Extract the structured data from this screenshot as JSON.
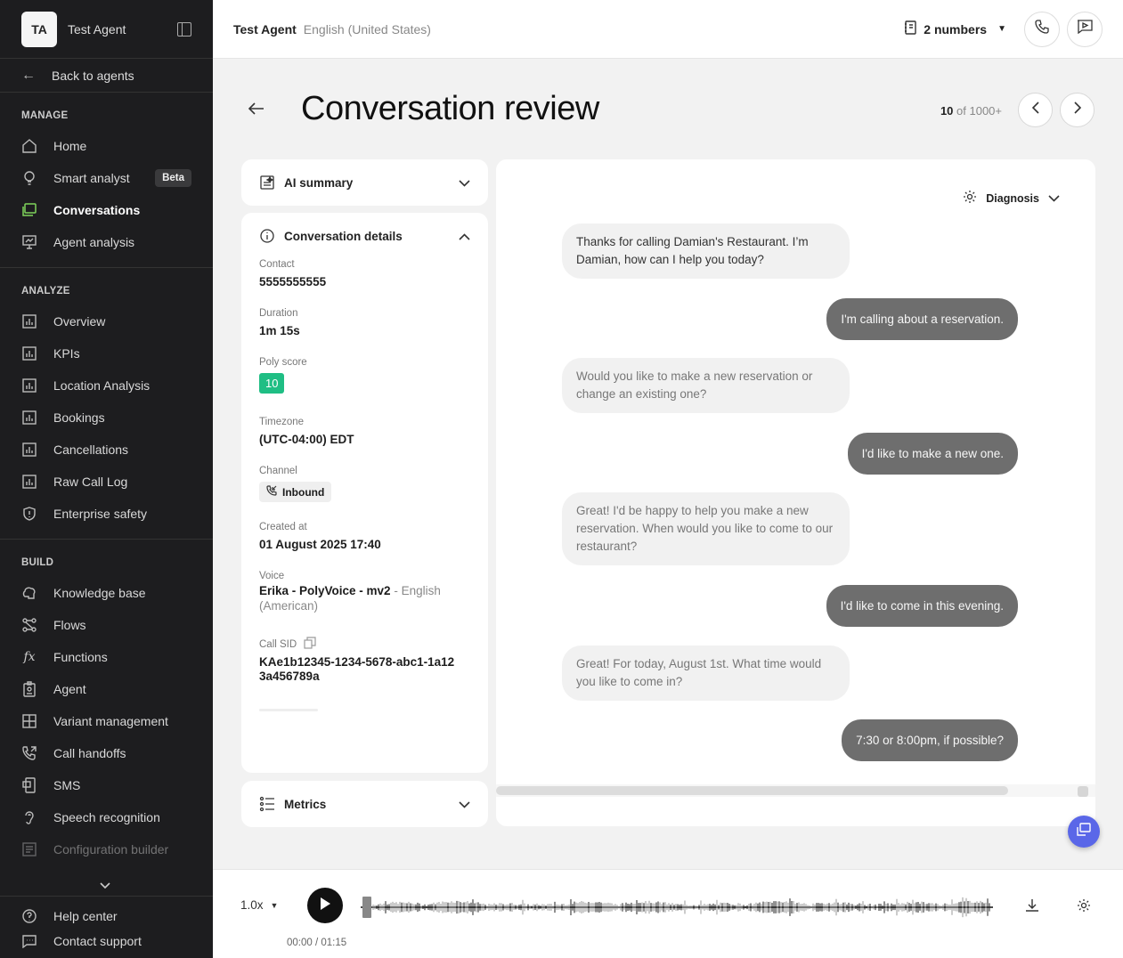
{
  "sidebar": {
    "avatar": "TA",
    "agent_name": "Test Agent",
    "back_label": "Back to agents",
    "manage": {
      "title": "MANAGE",
      "items": [
        {
          "label": "Home"
        },
        {
          "label": "Smart analyst",
          "badge": "Beta"
        },
        {
          "label": "Conversations"
        },
        {
          "label": "Agent analysis"
        }
      ]
    },
    "analyze": {
      "title": "ANALYZE",
      "items": [
        {
          "label": "Overview"
        },
        {
          "label": "KPIs"
        },
        {
          "label": "Location Analysis"
        },
        {
          "label": "Bookings"
        },
        {
          "label": "Cancellations"
        },
        {
          "label": "Raw Call Log"
        },
        {
          "label": "Enterprise safety"
        }
      ]
    },
    "build": {
      "title": "BUILD",
      "items": [
        {
          "label": "Knowledge base"
        },
        {
          "label": "Flows"
        },
        {
          "label": "Functions"
        },
        {
          "label": "Agent"
        },
        {
          "label": "Variant management"
        },
        {
          "label": "Call handoffs"
        },
        {
          "label": "SMS"
        },
        {
          "label": "Speech recognition"
        },
        {
          "label": "Configuration builder"
        }
      ]
    },
    "footer": [
      {
        "label": "Help center"
      },
      {
        "label": "Contact support"
      }
    ]
  },
  "topbar": {
    "agent": "Test Agent",
    "language": "English (United States)",
    "numbers": "2 numbers"
  },
  "page": {
    "title": "Conversation review",
    "pager_current": "10",
    "pager_total": "of 1000+"
  },
  "summary_card": {
    "title": "AI summary"
  },
  "details_card": {
    "title": "Conversation details",
    "contact_label": "Contact",
    "contact": "5555555555",
    "duration_label": "Duration",
    "duration": "1m 15s",
    "score_label": "Poly score",
    "score": "10",
    "timezone_label": "Timezone",
    "timezone": "(UTC-04:00) EDT",
    "channel_label": "Channel",
    "channel": "Inbound",
    "created_label": "Created at",
    "created": "01 August 2025 17:40",
    "voice_label": "Voice",
    "voice_name": "Erika - PolyVoice - mv2",
    "voice_lang": "- English (American)",
    "sid_label": "Call SID",
    "sid": "KAe1b12345-1234-5678-abc1-1a123a456789a"
  },
  "metrics_card": {
    "title": "Metrics"
  },
  "chat": {
    "diagnosis_label": "Diagnosis",
    "messages": [
      {
        "role": "agent",
        "text": "Thanks for calling Damian's Restaurant. I’m Damian, how can I help you today?"
      },
      {
        "role": "user",
        "text": "I'm calling about a reservation."
      },
      {
        "role": "agent",
        "text": "Would you like to make a new reservation or change an existing one?"
      },
      {
        "role": "user",
        "text": "I'd like to make a new one."
      },
      {
        "role": "agent",
        "text": "Great! I'd be happy to help you make a new reservation. When would you like to come to our restaurant?"
      },
      {
        "role": "user",
        "text": "I'd like to come in this evening."
      },
      {
        "role": "agent",
        "text": "Great! For today, August 1st. What time would you like to come in?"
      },
      {
        "role": "user",
        "text": "7:30 or 8:00pm, if possible?"
      }
    ]
  },
  "player": {
    "speed": "1.0x",
    "time": "00:00 / 01:15",
    "progress": 0
  },
  "colors": {
    "sidebar_bg": "#1d1d1f",
    "active_icon": "#7fd35b",
    "score_badge": "#1fbe84",
    "user_bubble": "#6e6e6e",
    "fab": "#5a67e8"
  }
}
